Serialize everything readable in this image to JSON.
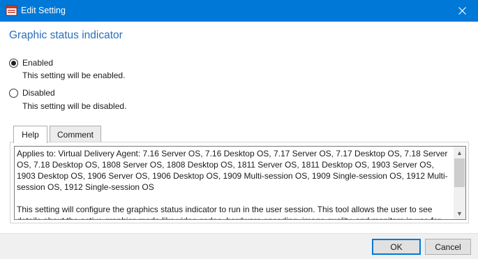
{
  "window": {
    "title": "Edit Setting",
    "icon": "citrix-policy-icon",
    "close_icon": "close-icon"
  },
  "setting": {
    "title": "Graphic status indicator"
  },
  "options": [
    {
      "label": "Enabled",
      "description": "This setting will be enabled.",
      "checked": true
    },
    {
      "label": "Disabled",
      "description": "This setting will be disabled.",
      "checked": false
    }
  ],
  "tabs": [
    {
      "label": "Help",
      "active": true
    },
    {
      "label": "Comment",
      "active": false
    }
  ],
  "help": {
    "applies_to": "Applies to: Virtual Delivery Agent: 7.16 Server OS, 7.16 Desktop OS, 7.17 Server OS, 7.17 Desktop OS, 7.18 Server OS, 7.18 Desktop OS, 1808 Server OS, 1808 Desktop OS, 1811 Server OS, 1811 Desktop OS, 1903 Server OS, 1903 Desktop OS, 1906 Server OS, 1906 Desktop OS, 1909 Multi-session OS, 1909 Single-session OS, 1912 Multi-session OS, 1912 Single-session OS",
    "description": "This setting will configure the graphics status indicator to run in the user session. This tool allows the user to see details about the active graphics mode like video codec, hardware encoding, image quality, and monitors in use for"
  },
  "buttons": {
    "ok": "OK",
    "cancel": "Cancel"
  },
  "colors": {
    "titlebar": "#0078d7",
    "heading": "#2a6fb6"
  }
}
